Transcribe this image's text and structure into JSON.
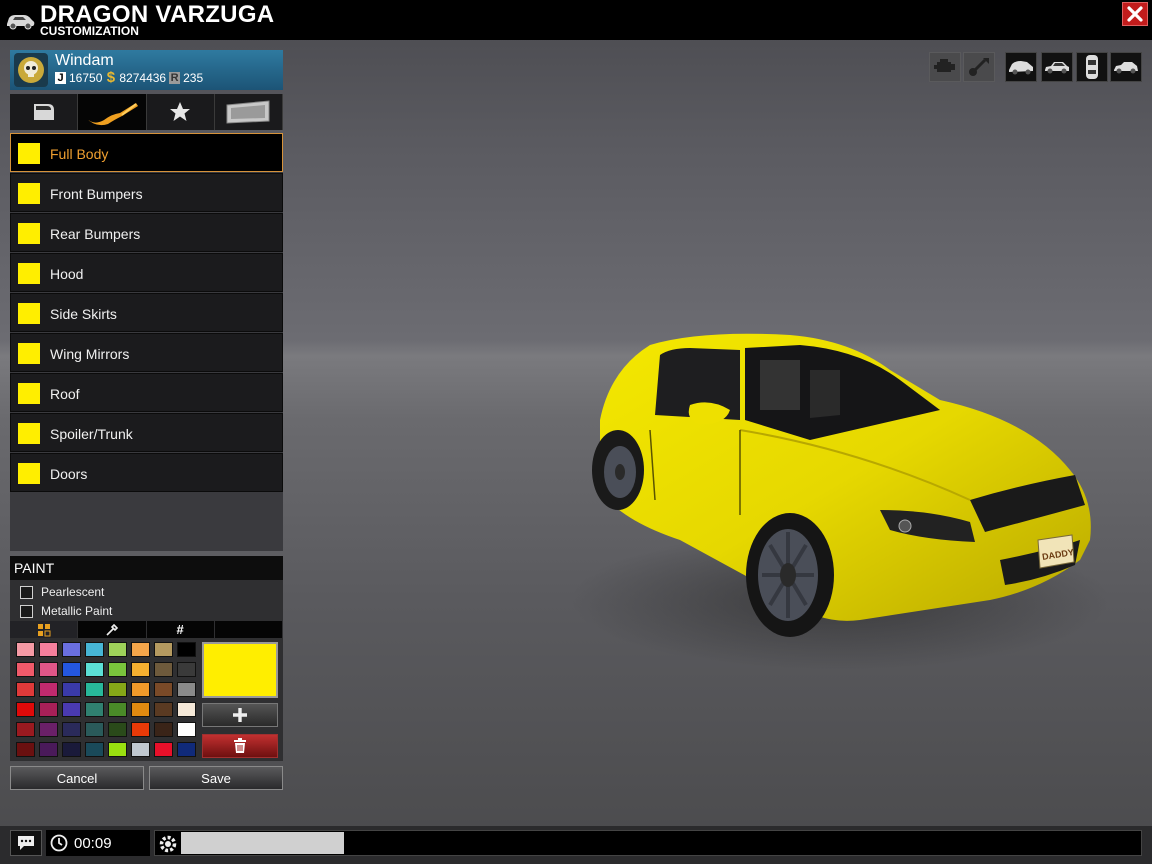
{
  "window": {
    "title": "DRAGON VARZUGA",
    "subtitle": "CUSTOMIZATION"
  },
  "player": {
    "name": "Windam",
    "jobs_points": "16750",
    "money": "8274436",
    "rank": "235"
  },
  "tabs": [
    {
      "icon": "car-door-icon"
    },
    {
      "icon": "paint-brush-icon",
      "active": true
    },
    {
      "icon": "star-icon"
    },
    {
      "icon": "license-plate-icon"
    }
  ],
  "parts": [
    {
      "label": "Full Body",
      "color": "#ffee00",
      "active": true
    },
    {
      "label": "Front Bumpers",
      "color": "#ffee00"
    },
    {
      "label": "Rear Bumpers",
      "color": "#ffee00"
    },
    {
      "label": "Hood",
      "color": "#ffee00"
    },
    {
      "label": "Side Skirts",
      "color": "#ffee00"
    },
    {
      "label": "Wing Mirrors",
      "color": "#ffee00"
    },
    {
      "label": "Roof",
      "color": "#ffee00"
    },
    {
      "label": "Spoiler/Trunk",
      "color": "#ffee00"
    },
    {
      "label": "Doors",
      "color": "#ffee00"
    }
  ],
  "paint": {
    "header": "PAINT",
    "pearlescent_label": "Pearlescent",
    "metallic_label": "Metallic Paint",
    "hex_tab_symbol": "#",
    "selected_color": "#ffee00",
    "palette": [
      "#f59aa5",
      "#f57f9c",
      "#6a6fe0",
      "#47b6d6",
      "#9fd25a",
      "#f5a64a",
      "#b59a60",
      "#000000",
      "#f05a6a",
      "#e05688",
      "#2457e0",
      "#5ce0d6",
      "#7ac43c",
      "#f5b030",
      "#6e5a3c",
      "#3a3a3a",
      "#e03a3a",
      "#c02a6e",
      "#3a3aa8",
      "#28b89a",
      "#86a818",
      "#f09a2a",
      "#7a4a28",
      "#8a8a8a",
      "#e00a0a",
      "#a82058",
      "#4a3ab0",
      "#308070",
      "#4a8a28",
      "#e08a10",
      "#5a3a22",
      "#f5e8d8",
      "#9a1a20",
      "#6a2068",
      "#2a2a5a",
      "#2a5a5a",
      "#2a4a1a",
      "#e83a08",
      "#3a2418",
      "#ffffff",
      "#6a1010",
      "#4a1a5a",
      "#1a1a3a",
      "#1a4a5a",
      "#9ae010",
      "#c0c8d0",
      "#e8102a",
      "#102a7a"
    ]
  },
  "actions": {
    "cancel": "Cancel",
    "save": "Save"
  },
  "camera_buttons": [
    "engine-icon",
    "horn-icon",
    "car-front-icon",
    "car-side-icon",
    "car-top-icon",
    "car-rear-icon"
  ],
  "status": {
    "timer": "00:09",
    "progress": 0.17
  },
  "car": {
    "plate": "DADDY",
    "body_color": "#ffee00"
  }
}
